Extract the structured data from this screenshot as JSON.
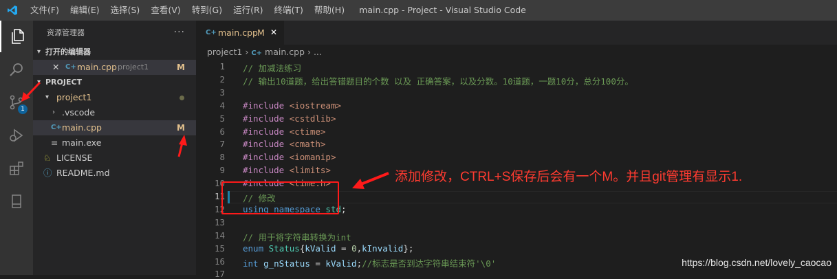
{
  "window": {
    "title": "main.cpp - Project - Visual Studio Code",
    "menu": [
      "文件(F)",
      "编辑(E)",
      "选择(S)",
      "查看(V)",
      "转到(G)",
      "运行(R)",
      "终端(T)",
      "帮助(H)"
    ]
  },
  "activity_bar": {
    "items": [
      "files-icon",
      "search-icon",
      "source-control-icon",
      "run-debug-icon",
      "extensions-icon",
      "remote-explorer-icon"
    ],
    "source_control_badge": "1"
  },
  "sidebar": {
    "title": "资源管理器",
    "more": "···",
    "open_editors": {
      "label": "打开的编辑器",
      "items": [
        {
          "close": "✕",
          "name": "main.cpp",
          "folder": "project1",
          "status": "M"
        }
      ]
    },
    "project": {
      "label": "PROJECT",
      "tree": [
        {
          "name": "project1",
          "kind": "folder",
          "depth": 1
        },
        {
          "name": ".vscode",
          "kind": "folder",
          "depth": 2
        },
        {
          "name": "main.cpp",
          "kind": "cpp",
          "depth": 2,
          "status": "M"
        },
        {
          "name": "main.exe",
          "kind": "file",
          "depth": 2
        },
        {
          "name": "LICENSE",
          "kind": "license",
          "depth": 1
        },
        {
          "name": "README.md",
          "kind": "info",
          "depth": 1
        }
      ]
    }
  },
  "editor": {
    "tab": {
      "name": "main.cpp",
      "status": "M",
      "close": "✕"
    },
    "breadcrumb": {
      "folder": "project1",
      "file": "main.cpp",
      "tail": "..."
    },
    "lines": [
      {
        "n": "1",
        "tokens": [
          {
            "t": "// 加减法练习",
            "c": "cm"
          }
        ]
      },
      {
        "n": "2",
        "tokens": [
          {
            "t": "// 输出10道题，给出答错题目的个数 以及 正确答案，以及分数。10道题，一题10分，总分100分。",
            "c": "cm"
          }
        ]
      },
      {
        "n": "3",
        "tokens": []
      },
      {
        "n": "4",
        "tokens": [
          {
            "t": "#include ",
            "c": "pp"
          },
          {
            "t": "<iostream>",
            "c": "st"
          }
        ]
      },
      {
        "n": "5",
        "tokens": [
          {
            "t": "#include ",
            "c": "pp"
          },
          {
            "t": "<cstdlib>",
            "c": "st"
          }
        ]
      },
      {
        "n": "6",
        "tokens": [
          {
            "t": "#include ",
            "c": "pp"
          },
          {
            "t": "<ctime>",
            "c": "st"
          }
        ]
      },
      {
        "n": "7",
        "tokens": [
          {
            "t": "#include ",
            "c": "pp"
          },
          {
            "t": "<cmath>",
            "c": "st"
          }
        ]
      },
      {
        "n": "8",
        "tokens": [
          {
            "t": "#include ",
            "c": "pp"
          },
          {
            "t": "<iomanip>",
            "c": "st"
          }
        ]
      },
      {
        "n": "9",
        "tokens": [
          {
            "t": "#include ",
            "c": "pp"
          },
          {
            "t": "<limits>",
            "c": "st"
          }
        ]
      },
      {
        "n": "10",
        "tokens": [
          {
            "t": "#include ",
            "c": "pp"
          },
          {
            "t": "<time.h>",
            "c": "st"
          }
        ]
      },
      {
        "n": "11",
        "tokens": [
          {
            "t": "// 修改",
            "c": "cm"
          }
        ]
      },
      {
        "n": "12",
        "tokens": [
          {
            "t": "using ",
            "c": "kw"
          },
          {
            "t": "namespace ",
            "c": "kw"
          },
          {
            "t": "std",
            "c": "en"
          },
          {
            "t": ";",
            "c": "tx"
          }
        ]
      },
      {
        "n": "13",
        "tokens": []
      },
      {
        "n": "14",
        "tokens": [
          {
            "t": "// 用于将字符串转换为int",
            "c": "cm"
          }
        ]
      },
      {
        "n": "15",
        "tokens": [
          {
            "t": "enum ",
            "c": "kw"
          },
          {
            "t": "Status",
            "c": "en"
          },
          {
            "t": "{",
            "c": "tx"
          },
          {
            "t": "kValid",
            "c": "va"
          },
          {
            "t": " = ",
            "c": "tx"
          },
          {
            "t": "0",
            "c": "nm"
          },
          {
            "t": ",",
            "c": "tx"
          },
          {
            "t": "kInvalid",
            "c": "va"
          },
          {
            "t": "};",
            "c": "tx"
          }
        ]
      },
      {
        "n": "16",
        "tokens": [
          {
            "t": "int ",
            "c": "kw"
          },
          {
            "t": "g_nStatus",
            "c": "va"
          },
          {
            "t": " = ",
            "c": "tx"
          },
          {
            "t": "kValid",
            "c": "va"
          },
          {
            "t": ";",
            "c": "tx"
          },
          {
            "t": "//标志是否到达字符串结束符'\\0'",
            "c": "cm"
          }
        ]
      },
      {
        "n": "17",
        "tokens": []
      }
    ],
    "current_line": "11"
  },
  "annotation": {
    "text": "添加修改，CTRL+S保存后会有一个M。并且git管理有显示1."
  },
  "watermark": "https://blog.csdn.net/lovely_caocao",
  "colors": {
    "annotation_red": "#ff1a1a",
    "modified": "#e2c08d",
    "accent": "#0e639c"
  }
}
